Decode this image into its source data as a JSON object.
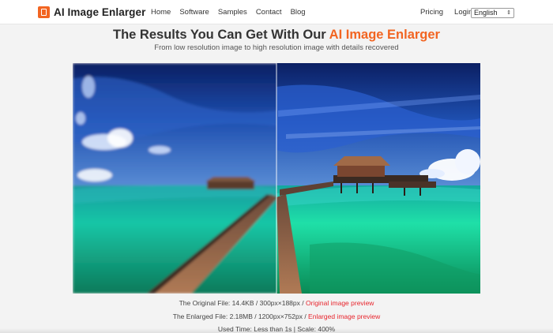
{
  "header": {
    "logo_text": "AI Image Enlarger",
    "nav": [
      "Home",
      "Software",
      "Samples",
      "Contact",
      "Blog"
    ],
    "pricing": "Pricing",
    "login": "Login",
    "language": "English"
  },
  "hero": {
    "title_prefix": "The Results You Can Get With Our ",
    "title_highlight": "AI Image Enlarger",
    "subtitle": "From low resolution image to high resolution image with details recovered"
  },
  "results": {
    "original_label": "The Original File: 14.4KB / 300px×188px / ",
    "original_link": "Original image preview",
    "enlarged_label": "The Enlarged File: 2.18MB / 1200px×752px / ",
    "enlarged_link": "Enlarged image preview",
    "time": "Used Time: Less than 1s | Scale: 400%"
  },
  "colors": {
    "accent": "#f26522",
    "link": "#e8252d"
  }
}
